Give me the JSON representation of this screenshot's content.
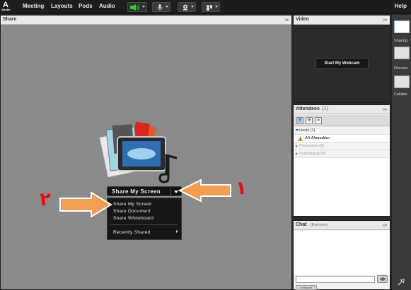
{
  "menubar": {
    "items": [
      "Meeting",
      "Layouts",
      "Pods",
      "Audio"
    ],
    "help": "Help",
    "logo_text": "Adobe"
  },
  "share_pod": {
    "title": "Share",
    "button_label": "Share My Screen",
    "dropdown": [
      "Share My Screen",
      "Share Document",
      "Share Whiteboard"
    ],
    "recently_shared": "Recently Shared",
    "annotation_1": "١",
    "annotation_2": "٢",
    "arrow_color": "#f0a050",
    "annotation_color": "#e01010"
  },
  "video_pod": {
    "title": "Video",
    "webcam_button": "Start My Webcam"
  },
  "attendees_pod": {
    "title": "Attendees",
    "count": "(1)",
    "groups": [
      {
        "label": "Hosts (1)",
        "expanded": true
      },
      {
        "label": "Presenters (0)",
        "expanded": false
      },
      {
        "label": "Participants (0)",
        "expanded": false
      }
    ],
    "host_name": "Ali Ahmedian"
  },
  "chat_pod": {
    "title": "Chat",
    "subtitle": "(Everyone)",
    "tab_label": "Everyone"
  },
  "rail": {
    "labels": [
      "Sharing",
      "Discuss",
      "Collabo"
    ]
  }
}
